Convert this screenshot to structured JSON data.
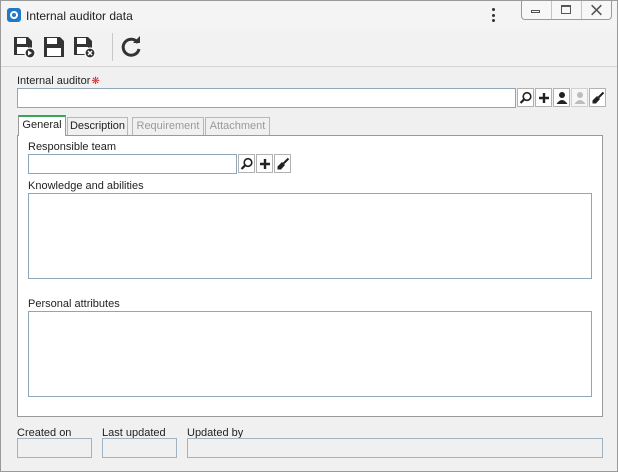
{
  "window": {
    "title": "Internal auditor data",
    "controls": [
      "minimize-icon",
      "restore-icon",
      "close-icon"
    ]
  },
  "toolbar": {
    "buttons": [
      "save-and-new-icon",
      "save-icon",
      "save-and-close-icon",
      "refresh-icon"
    ]
  },
  "form": {
    "internal_auditor_label": "Internal auditor",
    "internal_auditor_required": "❋",
    "internal_auditor_value": "",
    "internal_auditor_buttons": [
      "search-icon",
      "add-icon",
      "user-icon",
      "user-disabled-icon",
      "clear-icon"
    ]
  },
  "tabs": [
    {
      "label": "General",
      "state": "active"
    },
    {
      "label": "Description",
      "state": "enabled"
    },
    {
      "label": "Requirement",
      "state": "disabled"
    },
    {
      "label": "Attachment",
      "state": "disabled"
    }
  ],
  "general": {
    "responsible_team_label": "Responsible team",
    "responsible_team_value": "",
    "responsible_team_buttons": [
      "search-icon",
      "add-icon",
      "clear-icon"
    ],
    "knowledge_label": "Knowledge and abilities",
    "knowledge_value": "",
    "personal_attributes_label": "Personal attributes",
    "personal_attributes_value": ""
  },
  "footer": {
    "created_on_label": "Created on",
    "created_on_value": "",
    "last_updated_label": "Last updated",
    "last_updated_value": "",
    "updated_by_label": "Updated by",
    "updated_by_value": ""
  },
  "colors": {
    "active_tab_accent": "#3aa557",
    "required": "#e02020",
    "app_icon": "#1f78c8"
  }
}
